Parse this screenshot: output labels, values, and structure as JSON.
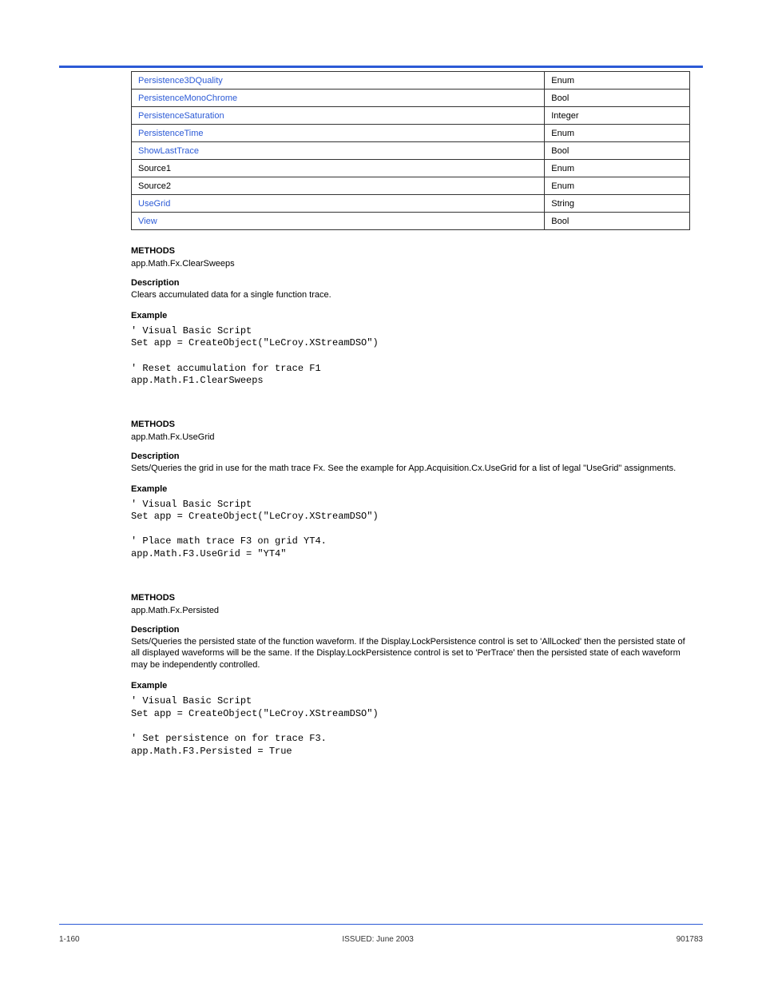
{
  "table": {
    "rows": [
      {
        "left": "Persistence3DQuality",
        "left_href": true,
        "right": "Enum"
      },
      {
        "left": "PersistenceMonoChrome",
        "left_href": true,
        "right": "Bool"
      },
      {
        "left": "PersistenceSaturation",
        "left_href": true,
        "right": "Integer"
      },
      {
        "left": "PersistenceTime",
        "left_href": true,
        "right": "Enum"
      },
      {
        "left": "ShowLastTrace",
        "left_href": true,
        "right": "Bool"
      },
      {
        "left": "Source1",
        "left_href": false,
        "right": "Enum"
      },
      {
        "left": "Source2",
        "left_href": false,
        "right": "Enum"
      },
      {
        "left": "UseGrid",
        "left_href": true,
        "right": "String"
      },
      {
        "left": "View",
        "left_href": true,
        "right": "Bool"
      }
    ]
  },
  "methods": [
    {
      "heading": "METHODS",
      "signature": "app.Math.Fx.ClearSweeps",
      "desc_label": "Description",
      "desc_text": "Clears accumulated data for a single function trace.",
      "example_label": "Example",
      "code": "' Visual Basic Script\nSet app = CreateObject(\"LeCroy.XStreamDSO\")\n\n' Reset accumulation for trace F1\napp.Math.F1.ClearSweeps"
    },
    {
      "heading": "METHODS",
      "signature": "app.Math.Fx.UseGrid",
      "desc_label": "Description",
      "desc_text": "Sets/Queries the grid in use for the math trace Fx. See the example for App.Acquisition.Cx.UseGrid for a list of legal \"UseGrid\" assignments.",
      "example_label": "Example",
      "code": "' Visual Basic Script\nSet app = CreateObject(\"LeCroy.XStreamDSO\")\n\n' Place math trace F3 on grid YT4.\napp.Math.F3.UseGrid = \"YT4\""
    },
    {
      "heading": "METHODS",
      "signature": "app.Math.Fx.Persisted",
      "desc_label": "Description",
      "desc_text": "Sets/Queries the persisted state of the function waveform. If the Display.LockPersistence control is set to 'AllLocked' then the persisted state of all displayed waveforms will be the same. If the Display.LockPersistence control is set to 'PerTrace' then the persisted state of each waveform may be independently controlled.",
      "example_label": "Example",
      "code": "' Visual Basic Script\nSet app = CreateObject(\"LeCroy.XStreamDSO\")\n\n' Set persistence on for trace F3.\napp.Math.F3.Persisted = True"
    }
  ],
  "footer": {
    "left": "1-160",
    "right": "ISSUED: June 2003",
    "far_right": "901783"
  }
}
